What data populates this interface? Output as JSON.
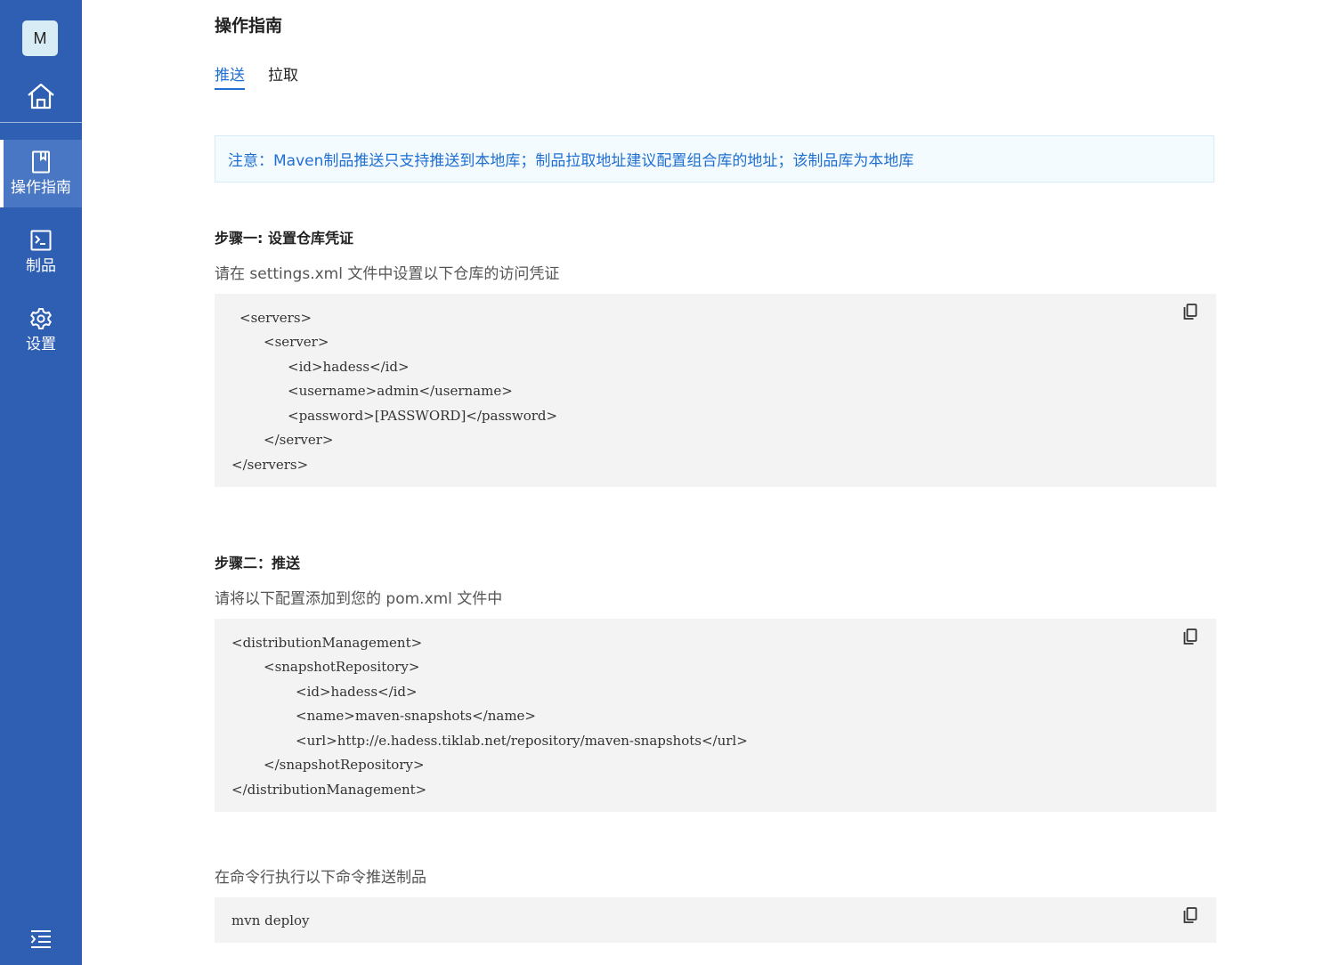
{
  "sidebar": {
    "avatar_letter": "M",
    "home_icon": "home-icon",
    "items": [
      {
        "label": "操作指南",
        "icon": "book-icon",
        "active": true
      },
      {
        "label": "制品",
        "icon": "terminal-icon",
        "active": false
      },
      {
        "label": "设置",
        "icon": "gear-icon",
        "active": false
      }
    ],
    "collapse_icon": "menu-collapse-icon"
  },
  "page": {
    "title": "操作指南",
    "tabs": [
      {
        "label": "推送",
        "active": true
      },
      {
        "label": "拉取",
        "active": false
      }
    ],
    "notice": "注意：Maven制品推送只支持推送到本地库；制品拉取地址建议配置组合库的地址；该制品库为本地库"
  },
  "step1": {
    "title": "步骤一: 设置仓库凭证",
    "desc": "请在 settings.xml 文件中设置以下仓库的访问凭证",
    "code": [
      "<servers>",
      "<server>",
      "<id>hadess</id>",
      "<username>admin</username>",
      "<password>[PASSWORD]</password>",
      "</server>",
      "</servers>"
    ]
  },
  "step2": {
    "title": "步骤二：推送",
    "desc": "请将以下配置添加到您的 pom.xml 文件中",
    "code": [
      "<distributionManagement>",
      "<snapshotRepository>",
      "<id>hadess</id>",
      "<name>maven-snapshots</name>",
      "<url>http://e.hadess.tiklab.net/repository/maven-snapshots</url>",
      "</snapshotRepository>",
      "</distributionManagement>"
    ]
  },
  "step3": {
    "desc": "在命令行执行以下命令推送制品",
    "code": "mvn deploy"
  },
  "colors": {
    "sidebar": "#2f5fb3",
    "accent": "#1f6fd1",
    "code_bg": "#f3f3f3"
  }
}
